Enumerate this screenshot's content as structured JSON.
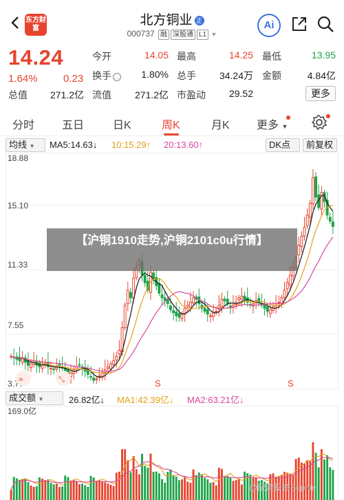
{
  "header": {
    "logo_text": "东方财富",
    "title": "北方铜业",
    "code": "000737",
    "tags": [
      "融",
      "深股通",
      "L1"
    ],
    "ai_label": "Ai"
  },
  "quote": {
    "price": "14.24",
    "change_pct": "1.64%",
    "change": "0.23",
    "fields": [
      {
        "label": "今开",
        "value": "14.05",
        "color": "red"
      },
      {
        "label": "最高",
        "value": "14.25",
        "color": "red"
      },
      {
        "label": "最低",
        "value": "13.95",
        "color": "green"
      },
      {
        "label": "换手",
        "value": "1.80%",
        "color": "plain"
      },
      {
        "label": "总手",
        "value": "34.24万",
        "color": "plain"
      },
      {
        "label": "金额",
        "value": "4.84亿",
        "color": "plain"
      },
      {
        "label": "总值",
        "value": "271.2亿",
        "color": "plain"
      },
      {
        "label": "流值",
        "value": "271.2亿",
        "color": "plain"
      },
      {
        "label": "市盈动",
        "value": "29.52",
        "color": "plain"
      }
    ],
    "more_label": "更多"
  },
  "tabs": [
    "分时",
    "五日",
    "日K",
    "周K",
    "月K",
    "更多"
  ],
  "active_tab": "周K",
  "ma_bar": {
    "type_select": "均线",
    "ma5": "MA5:14.63↓",
    "ma10": "10:15.29↑",
    "ma20": "20:13.60↑",
    "dk_select": "DK点",
    "adjust_label": "前复权"
  },
  "chart_data": {
    "type": "candlestick",
    "y_ticks": [
      "18.88",
      "15.10",
      "11.33",
      "7.55",
      "3.77"
    ],
    "ylim": [
      3.77,
      18.88
    ],
    "markers": [
      "S",
      "S"
    ],
    "candles_close": [
      5.6,
      5.5,
      5.4,
      5.3,
      5.5,
      5.2,
      5.0,
      5.1,
      5.2,
      5.0,
      4.9,
      5.0,
      5.1,
      4.9,
      4.8,
      4.7,
      4.9,
      5.0,
      4.8,
      4.6,
      4.4,
      4.5,
      4.7,
      4.9,
      5.0,
      4.8,
      4.6,
      4.4,
      4.2,
      4.0,
      4.1,
      4.3,
      4.5,
      4.7,
      4.9,
      5.1,
      5.3,
      5.6,
      6.0,
      7.5,
      9.0,
      10.0,
      9.5,
      10.8,
      11.5,
      12.0,
      11.0,
      10.5,
      10.0,
      11.2,
      10.8,
      10.3,
      9.8,
      9.5,
      9.3,
      9.1,
      8.7,
      8.5,
      8.3,
      8.2,
      8.4,
      8.8,
      9.0,
      9.2,
      9.5,
      9.4,
      9.1,
      8.8,
      8.6,
      8.4,
      8.3,
      8.5,
      8.6,
      9.0,
      9.4,
      9.3,
      9.1,
      8.9,
      9.0,
      9.2,
      9.5,
      9.6,
      9.4,
      9.2,
      9.0,
      9.1,
      9.3,
      9.2,
      9.0,
      8.8,
      8.6,
      8.7,
      8.9,
      9.0,
      9.2,
      9.5,
      10.0,
      10.5,
      11.0,
      11.5,
      12.2,
      13.0,
      13.6,
      14.2,
      15.0,
      15.8,
      17.5,
      16.2,
      15.5,
      16.5,
      15.9,
      15.0,
      14.6,
      14.24
    ]
  },
  "volume": {
    "select": "成交额",
    "amount": "26.82亿↓",
    "ma1": "MA1:42.39亿↓",
    "ma2": "MA2:63.21亿↓",
    "y_top": "169.0亿"
  },
  "banner_text": "【沪铜1910走势,沪铜2101c0u行情】",
  "bottom_watermark": "@配资投资Sophie",
  "colors": {
    "up": "#e8432e",
    "down": "#1ea34a",
    "ma5": "#222222",
    "ma10": "#e3a21a",
    "ma20": "#d8479f"
  }
}
